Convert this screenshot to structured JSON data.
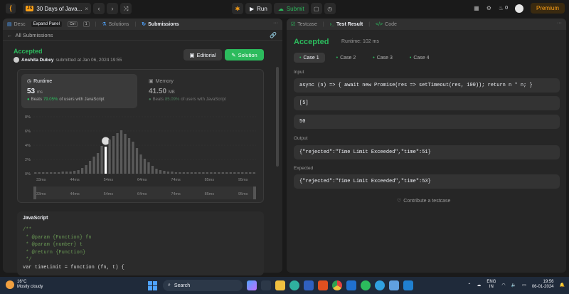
{
  "topbar": {
    "study_badge": "JS",
    "study_title": "30 Days of Java...",
    "run_label": "Run",
    "submit_label": "Submit",
    "streak": "0",
    "premium_label": "Premium"
  },
  "left_panel": {
    "tabs": [
      {
        "label": "Desc"
      },
      {
        "label": "Solutions"
      },
      {
        "label": "Submissions"
      }
    ],
    "expand_tooltip": "Expand Panel",
    "shortcut_ctrl": "Ctrl",
    "shortcut_key": "1",
    "back_link": "All Submissions",
    "status": "Accepted",
    "author_name": "Anshita Dubey",
    "submitted_text": "submitted at Jan 06, 2024 19:55",
    "editorial_label": "Editorial",
    "solution_label": "Solution",
    "runtime": {
      "label": "Runtime",
      "value": "53",
      "unit": "ms",
      "beats_prefix": "Beats",
      "beats_pct": "79.05%",
      "beats_suffix": "of users with JavaScript"
    },
    "memory": {
      "label": "Memory",
      "value": "41.50",
      "unit": "MB",
      "beats_prefix": "Beats",
      "beats_pct": "85.09%",
      "beats_suffix": "of users with JavaScript"
    },
    "code": {
      "language": "JavaScript",
      "lines": [
        "/**",
        " * @param {Function} fn",
        " * @param {number} t",
        " * @return {Function}",
        " */",
        "var timeLimit = function (fn, t) {"
      ]
    }
  },
  "chart_data": {
    "type": "bar",
    "ylabels": [
      "8%",
      "6%",
      "4%",
      "2%",
      "0%"
    ],
    "ylim": [
      0,
      8
    ],
    "xlabels": [
      "33ms",
      "44ms",
      "54ms",
      "64ms",
      "74ms",
      "85ms",
      "95ms"
    ],
    "values": [
      0.2,
      0.2,
      0.2,
      0.2,
      0.2,
      0.2,
      0.2,
      0.3,
      0.3,
      0.3,
      0.4,
      0.5,
      0.8,
      1.2,
      1.8,
      2.4,
      2.9,
      3.9,
      3.8,
      4.8,
      5.3,
      5.7,
      6.1,
      5.6,
      5.0,
      4.5,
      3.6,
      2.7,
      2.1,
      1.6,
      1.1,
      0.7,
      0.5,
      0.4,
      0.3,
      0.3,
      0.2,
      0.2,
      0.2,
      0.2,
      0.2,
      0.2,
      0.2,
      0.2,
      0.2,
      0.2,
      0.2,
      0.2,
      0.2,
      0.2,
      0.2,
      0.2,
      0.2,
      0.2,
      0.2,
      0.2,
      0.2
    ],
    "highlight_index": 18
  },
  "right_panel": {
    "tabs": [
      {
        "label": "Testcase"
      },
      {
        "label": "Test Result"
      },
      {
        "label": "Code"
      }
    ],
    "status": "Accepted",
    "runtime_text": "Runtime: 102 ms",
    "cases": [
      "Case 1",
      "Case 2",
      "Case 3",
      "Case 4"
    ],
    "input_label": "Input",
    "inputs": [
      "async (n) => { await new Promise(res => setTimeout(res, 100)); return n * n; }",
      "[5]",
      "50"
    ],
    "output_label": "Output",
    "output": "{\"rejected\":\"Time Limit Exceeded\",\"time\":51}",
    "expected_label": "Expected",
    "expected": "{\"rejected\":\"Time Limit Exceeded\",\"time\":53}",
    "contribute_label": "Contribute a testcase"
  },
  "taskbar": {
    "temp": "16°C",
    "weather": "Mostly cloudy",
    "search_placeholder": "Search",
    "lang": "ENG",
    "region": "IN",
    "time": "19:56",
    "date": "06-01-2024"
  },
  "colors": {
    "accent_green": "#2cbb5d",
    "accent_orange": "#ffa116",
    "panel_bg": "#262626"
  }
}
